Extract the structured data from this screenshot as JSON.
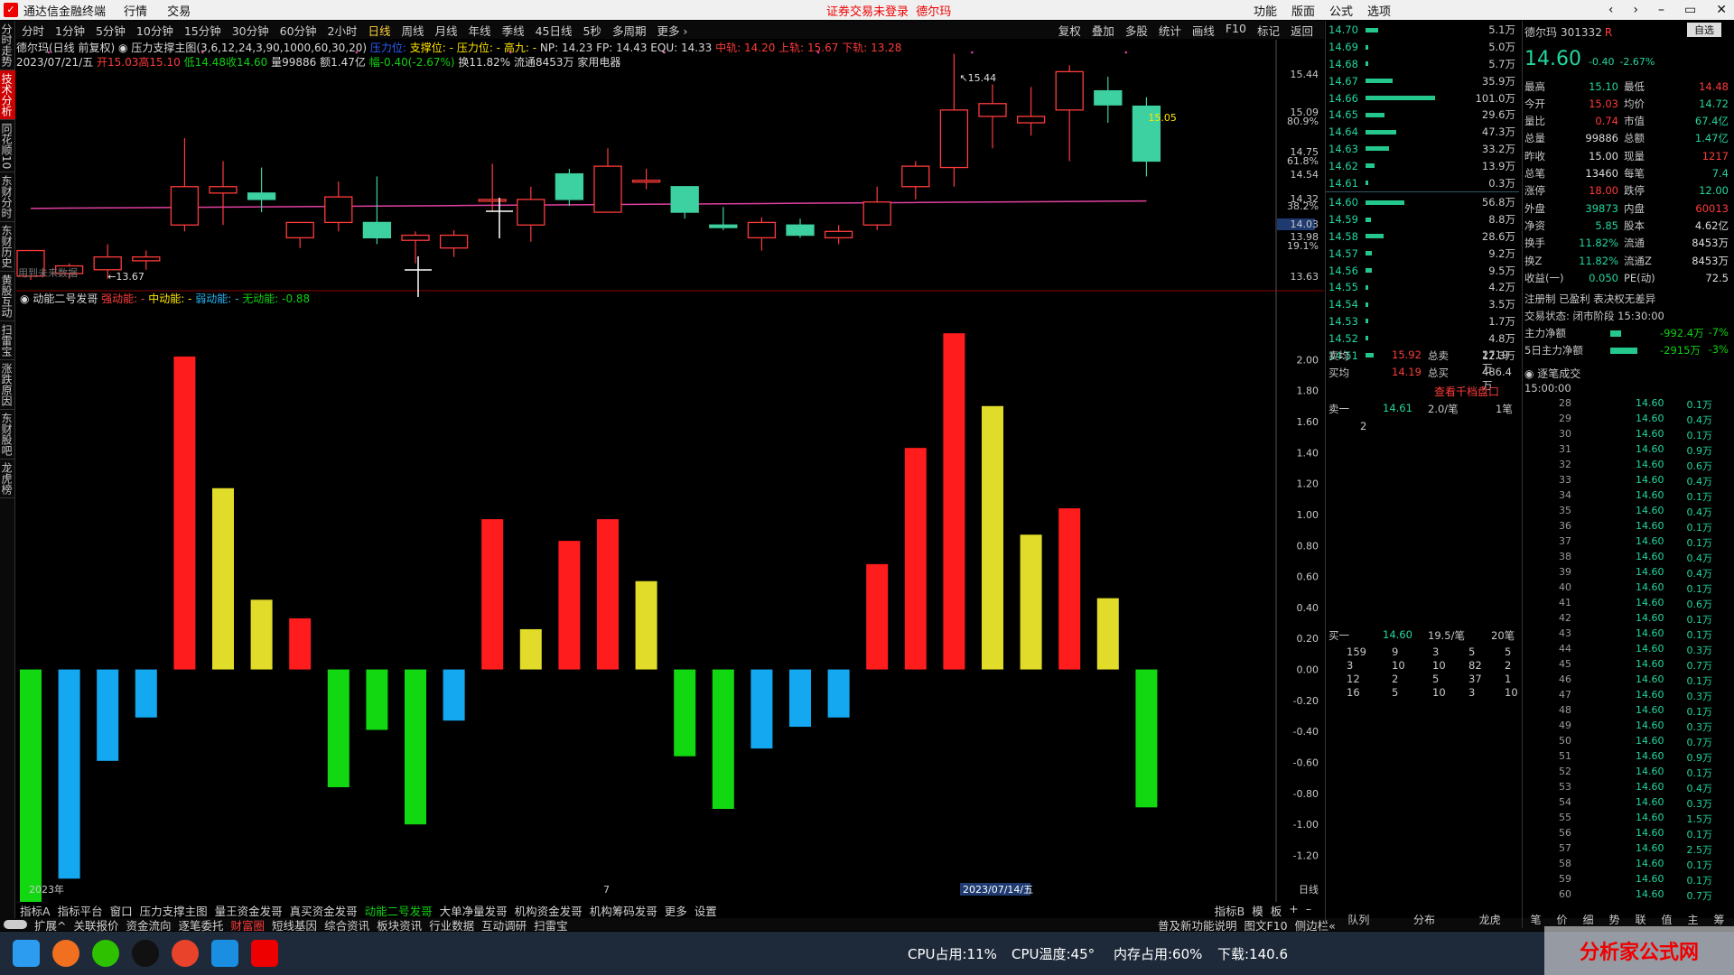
{
  "window": {
    "title": "通达信金融终端",
    "menu": [
      "行情",
      "交易"
    ],
    "warning": "证券交易未登录",
    "stock": "德尔玛",
    "right_menu": [
      "功能",
      "版面",
      "公式",
      "选项"
    ],
    "controls": [
      "‹",
      "›",
      "–",
      "▭",
      "✕"
    ]
  },
  "toolbar": {
    "periods": [
      "分时",
      "1分钟",
      "5分钟",
      "10分钟",
      "15分钟",
      "30分钟",
      "60分钟",
      "2小时",
      "日线",
      "周线",
      "月线",
      "年线",
      "季线",
      "45日线",
      "5秒",
      "多周期",
      "更多 ›"
    ],
    "active": "日线",
    "right": [
      "复权",
      "叠加",
      "多股",
      "统计",
      "画线",
      "F10",
      "标记",
      "返回"
    ]
  },
  "left_tabs": [
    "分时走势",
    "技术分析",
    "同花顺10",
    "东财分时",
    "东财历史",
    "黄股互动",
    "扫雷宝",
    "涨跌原因",
    "东财股吧",
    "龙虎榜"
  ],
  "left_active": "技术分析",
  "info": {
    "line1_name": "德尔玛(日线 前复权)",
    "line1_ind": "压力支撑主图(3,6,12,24,3,90,1000,60,30,20)",
    "l1_a": "压力位:",
    "l1_b": "支撑位: -",
    "l1_c": "压力位: -",
    "l1_d": "高九: -",
    "l1_e": "NP: 14.23 FP: 14.43 EQU: 14.33",
    "l1_f": "中轨: 14.20 上轨: 15.67 下轨: 13.28",
    "line2_date": "2023/07/21/五",
    "line2_open": "开15.03",
    "line2_high": "高15.10",
    "line2_low": "低14.48",
    "line2_close": "收14.60",
    "line2_vol": "量99886 额1.47亿",
    "line2_chg": "幅-0.40(-2.67%)",
    "line2_rest": "换11.82% 流通8453万 家用电器",
    "no_future": "用到未来数据",
    "hi_label": "15.44",
    "lo_label": "13.67",
    "price_tag": "15.05",
    "sub_title": "动能二号发哥",
    "sub_a": "强动能: -",
    "sub_b": "中动能: -",
    "sub_c": "弱动能: -",
    "sub_d": "无动能: -0.88"
  },
  "axis_main": {
    "ticks": [
      "15.44",
      "15.09",
      "80.9%",
      "14.75",
      "61.8%",
      "14.54",
      "14.32",
      "38.2%",
      "14.03",
      "13.98",
      "19.1%",
      "13.63"
    ],
    "highlight": "14.03"
  },
  "axis_sub": {
    "ticks": [
      "2.00",
      "1.80",
      "1.60",
      "1.40",
      "1.20",
      "1.00",
      "0.80",
      "0.60",
      "0.40",
      "0.20",
      "0.00",
      "-0.20",
      "-0.40",
      "-0.60",
      "-0.80",
      "-1.00",
      "-1.20"
    ]
  },
  "xaxis": {
    "labels": [
      "2023年",
      "7",
      "2023/07/14/五"
    ],
    "period": "日线"
  },
  "chart_data": [
    {
      "type": "candlestick",
      "title": "德尔玛(日线 前复权)",
      "ylim": [
        13.6,
        15.55
      ],
      "candles": [
        {
          "o": 13.7,
          "h": 13.8,
          "l": 13.67,
          "c": 13.9
        },
        {
          "o": 13.72,
          "h": 13.8,
          "l": 13.68,
          "c": 13.78
        },
        {
          "o": 13.75,
          "h": 13.95,
          "l": 13.68,
          "c": 13.85
        },
        {
          "o": 13.82,
          "h": 13.9,
          "l": 13.75,
          "c": 13.85
        },
        {
          "o": 14.1,
          "h": 14.78,
          "l": 14.05,
          "c": 14.4
        },
        {
          "o": 14.35,
          "h": 14.6,
          "l": 14.1,
          "c": 14.4
        },
        {
          "o": 14.35,
          "h": 14.55,
          "l": 14.2,
          "c": 14.3
        },
        {
          "o": 14.0,
          "h": 14.12,
          "l": 13.92,
          "c": 14.12
        },
        {
          "o": 14.12,
          "h": 14.44,
          "l": 14.05,
          "c": 14.32
        },
        {
          "o": 14.12,
          "h": 14.48,
          "l": 13.95,
          "c": 14.0
        },
        {
          "o": 13.98,
          "h": 14.05,
          "l": 13.8,
          "c": 14.02
        },
        {
          "o": 13.92,
          "h": 14.06,
          "l": 13.85,
          "c": 14.02
        },
        {
          "o": 14.3,
          "h": 14.58,
          "l": 14.2,
          "c": 14.3
        },
        {
          "o": 14.1,
          "h": 14.4,
          "l": 13.97,
          "c": 14.3
        },
        {
          "o": 14.5,
          "h": 14.54,
          "l": 14.25,
          "c": 14.3
        },
        {
          "o": 14.2,
          "h": 14.7,
          "l": 14.2,
          "c": 14.56
        },
        {
          "o": 14.45,
          "h": 14.54,
          "l": 14.38,
          "c": 14.45
        },
        {
          "o": 14.4,
          "h": 14.4,
          "l": 14.15,
          "c": 14.2
        },
        {
          "o": 14.1,
          "h": 14.24,
          "l": 14.06,
          "c": 14.08
        },
        {
          "o": 14.0,
          "h": 14.16,
          "l": 13.9,
          "c": 14.12
        },
        {
          "o": 14.1,
          "h": 14.15,
          "l": 14.0,
          "c": 14.02
        },
        {
          "o": 14.0,
          "h": 14.1,
          "l": 13.95,
          "c": 14.05
        },
        {
          "o": 14.1,
          "h": 14.4,
          "l": 14.06,
          "c": 14.28
        },
        {
          "o": 14.4,
          "h": 14.6,
          "l": 14.3,
          "c": 14.56
        },
        {
          "o": 14.55,
          "h": 15.44,
          "l": 14.4,
          "c": 15.0
        },
        {
          "o": 14.95,
          "h": 15.2,
          "l": 14.7,
          "c": 15.05
        },
        {
          "o": 14.9,
          "h": 15.18,
          "l": 14.8,
          "c": 14.95
        },
        {
          "o": 15.0,
          "h": 15.35,
          "l": 14.6,
          "c": 15.3
        },
        {
          "o": 15.15,
          "h": 15.26,
          "l": 14.9,
          "c": 15.04
        },
        {
          "o": 15.03,
          "h": 15.1,
          "l": 14.48,
          "c": 14.6
        }
      ]
    },
    {
      "type": "bar",
      "title": "动能二号发哥",
      "ylim": [
        -1.5,
        2.2
      ],
      "values": [
        -1.53,
        -1.35,
        -0.59,
        -0.31,
        2.02,
        1.17,
        0.45,
        0.33,
        -0.76,
        -0.39,
        -1.0,
        -0.33,
        0.97,
        0.26,
        0.83,
        0.97,
        0.57,
        -0.56,
        -0.9,
        -0.51,
        -0.37,
        -0.31,
        0.68,
        1.43,
        2.17,
        1.7,
        0.87,
        1.04,
        0.46,
        -0.89
      ],
      "colors": [
        "grn",
        "cyn",
        "cyn",
        "cyn",
        "red",
        "yel",
        "yel",
        "red",
        "grn",
        "grn",
        "grn",
        "cyn",
        "red",
        "yel",
        "red",
        "red",
        "yel",
        "grn",
        "grn",
        "cyn",
        "cyn",
        "cyn",
        "red",
        "red",
        "red",
        "yel",
        "yel",
        "red",
        "yel",
        "grn"
      ]
    }
  ],
  "colors": {
    "red": "#ff1c1c",
    "yel": "#e1dc2a",
    "grn": "#12d812",
    "cyn": "#14a8f0",
    "up": "#ff3b3b",
    "down": "#3dd0a0",
    "ma": "#e040a0"
  },
  "quote": {
    "name": "德尔玛",
    "code": "301332",
    "flag": "R",
    "btn": "自选",
    "price": "14.60",
    "chg": "-0.40",
    "pct": "-2.67%",
    "asks": [
      [
        "14.70",
        "5.1万"
      ],
      [
        "14.69",
        "5.0万"
      ],
      [
        "14.68",
        "5.7万"
      ],
      [
        "14.67",
        "35.9万"
      ],
      [
        "14.66",
        "101.0万"
      ],
      [
        "14.65",
        "29.6万"
      ],
      [
        "14.64",
        "47.3万"
      ],
      [
        "14.63",
        "33.2万"
      ],
      [
        "14.62",
        "13.9万"
      ],
      [
        "14.61",
        "0.3万"
      ]
    ],
    "bids": [
      [
        "14.60",
        "56.8万"
      ],
      [
        "14.59",
        "8.8万"
      ],
      [
        "14.58",
        "28.6万"
      ],
      [
        "14.57",
        "9.2万"
      ],
      [
        "14.56",
        "9.5万"
      ],
      [
        "14.55",
        "4.2万"
      ],
      [
        "14.54",
        "3.5万"
      ],
      [
        "14.53",
        "1.7万"
      ],
      [
        "14.52",
        "4.8万"
      ],
      [
        "14.51",
        "12.3万"
      ]
    ],
    "ask_bars": [
      0.16,
      0.01,
      0.01,
      0.35,
      0.9,
      0.25,
      0.4,
      0.3,
      0.12,
      0.01
    ],
    "bid_bars": [
      0.5,
      0.07,
      0.24,
      0.08,
      0.08,
      0.04,
      0.03,
      0.01,
      0.04,
      0.1
    ],
    "avg_sell_label": "卖均",
    "avg_sell": "15.92",
    "total_sell_label": "总卖",
    "total_sell": "2719万",
    "avg_buy_label": "买均",
    "avg_buy": "14.19",
    "total_buy_label": "总买",
    "total_buy": "486.4万",
    "queue_link": "查看千档盘口",
    "sell1": "卖一",
    "sell1_price": "14.61",
    "sell1_per": "2.0/笔",
    "sell1_cnt": "1笔",
    "sell1_q": "2",
    "buy1": "买一",
    "buy1_price": "14.60",
    "buy1_per": "19.5/笔",
    "buy1_cnt": "20笔",
    "buy_queue": [
      [
        "159",
        "9",
        "3",
        "5",
        "5"
      ],
      [
        "3",
        "10",
        "10",
        "82",
        "2"
      ],
      [
        "12",
        "2",
        "5",
        "37",
        "1"
      ],
      [
        "16",
        "5",
        "10",
        "3",
        "10"
      ]
    ],
    "stats": [
      [
        "最高",
        "15.10",
        "最低",
        "14.48"
      ],
      [
        "今开",
        "15.03",
        "均价",
        "14.72"
      ],
      [
        "量比",
        "0.74",
        "市值",
        "67.4亿"
      ],
      [
        "总量",
        "99886",
        "总额",
        "1.47亿"
      ],
      [
        "昨收",
        "15.00",
        "现量",
        "1217"
      ],
      [
        "总笔",
        "13460",
        "每笔",
        "7.4"
      ],
      [
        "涨停",
        "18.00",
        "跌停",
        "12.00"
      ],
      [
        "外盘",
        "39873",
        "内盘",
        "60013"
      ],
      [
        "净资",
        "5.85",
        "股本",
        "4.62亿"
      ],
      [
        "换手",
        "11.82%",
        "流通",
        "8453万"
      ],
      [
        "换Z",
        "11.82%",
        "流通Z",
        "8453万"
      ],
      [
        "收益(一)",
        "0.050",
        "PE(动)",
        "72.5"
      ]
    ],
    "reg": "注册制 已盈利 表决权无差异",
    "status": "交易状态: 闭市阶段 15:30:00",
    "main_net_label": "主力净额",
    "main_net": "-992.4万",
    "main_net_pct": "-7%",
    "net5_label": "5日主力净额",
    "net5": "-2915万",
    "net5_pct": "-3%",
    "ticks_title": "逐笔成交",
    "ticks_time": "15:00:00",
    "ticks": [
      [
        "28",
        "14.60",
        "0.1万"
      ],
      [
        "29",
        "14.60",
        "0.4万"
      ],
      [
        "30",
        "14.60",
        "0.1万"
      ],
      [
        "31",
        "14.60",
        "0.9万"
      ],
      [
        "32",
        "14.60",
        "0.6万"
      ],
      [
        "33",
        "14.60",
        "0.4万"
      ],
      [
        "34",
        "14.60",
        "0.1万"
      ],
      [
        "35",
        "14.60",
        "0.4万"
      ],
      [
        "36",
        "14.60",
        "0.1万"
      ],
      [
        "37",
        "14.60",
        "0.1万"
      ],
      [
        "38",
        "14.60",
        "0.4万"
      ],
      [
        "39",
        "14.60",
        "0.4万"
      ],
      [
        "40",
        "14.60",
        "0.1万"
      ],
      [
        "41",
        "14.60",
        "0.6万"
      ],
      [
        "42",
        "14.60",
        "0.1万"
      ],
      [
        "43",
        "14.60",
        "0.1万"
      ],
      [
        "44",
        "14.60",
        "0.3万"
      ],
      [
        "45",
        "14.60",
        "0.7万"
      ],
      [
        "46",
        "14.60",
        "0.1万"
      ],
      [
        "47",
        "14.60",
        "0.3万"
      ],
      [
        "48",
        "14.60",
        "0.1万"
      ],
      [
        "49",
        "14.60",
        "0.3万"
      ],
      [
        "50",
        "14.60",
        "0.7万"
      ],
      [
        "51",
        "14.60",
        "0.9万"
      ],
      [
        "52",
        "14.60",
        "0.1万"
      ],
      [
        "53",
        "14.60",
        "0.4万"
      ],
      [
        "54",
        "14.60",
        "0.3万"
      ],
      [
        "55",
        "14.60",
        "1.5万"
      ],
      [
        "56",
        "14.60",
        "0.1万"
      ],
      [
        "57",
        "14.60",
        "2.5万"
      ],
      [
        "58",
        "14.60",
        "0.1万"
      ],
      [
        "59",
        "14.60",
        "0.1万"
      ],
      [
        "60",
        "14.60",
        "0.7万"
      ]
    ],
    "bottom_tabs": [
      "队列",
      "分布",
      "龙虎"
    ],
    "bottom_tabs2": [
      "笔",
      "价",
      "细",
      "势",
      "联",
      "值",
      "主",
      "筹"
    ]
  },
  "bottom1": {
    "items": [
      "指标A",
      "指标平台",
      "窗口",
      "压力支撑主图",
      "量王资金发哥",
      "真买资金发哥",
      "动能二号发哥",
      "大单净量发哥",
      "机构资金发哥",
      "机构筹码发哥",
      "更多",
      "设置"
    ],
    "active": "动能二号发哥",
    "right": [
      "指标B",
      "模",
      "板",
      "+",
      "–"
    ]
  },
  "bottom2": {
    "items": [
      "扩展^",
      "关联报价",
      "资金流向",
      "逐笔委托",
      "财富圈",
      "短线基因",
      "综合资讯",
      "板块资讯",
      "行业数据",
      "互动调研",
      "扫雷宝"
    ],
    "active": "财富圈",
    "right": [
      "普及新功能说明",
      "图文F10",
      "侧边栏«"
    ]
  },
  "taskbar": {
    "cpu": "CPU占用:11%",
    "temp": "CPU温度:45°",
    "mem": "内存占用:60%",
    "dl": "下载:140.6"
  },
  "watermark": "分析家公式网"
}
